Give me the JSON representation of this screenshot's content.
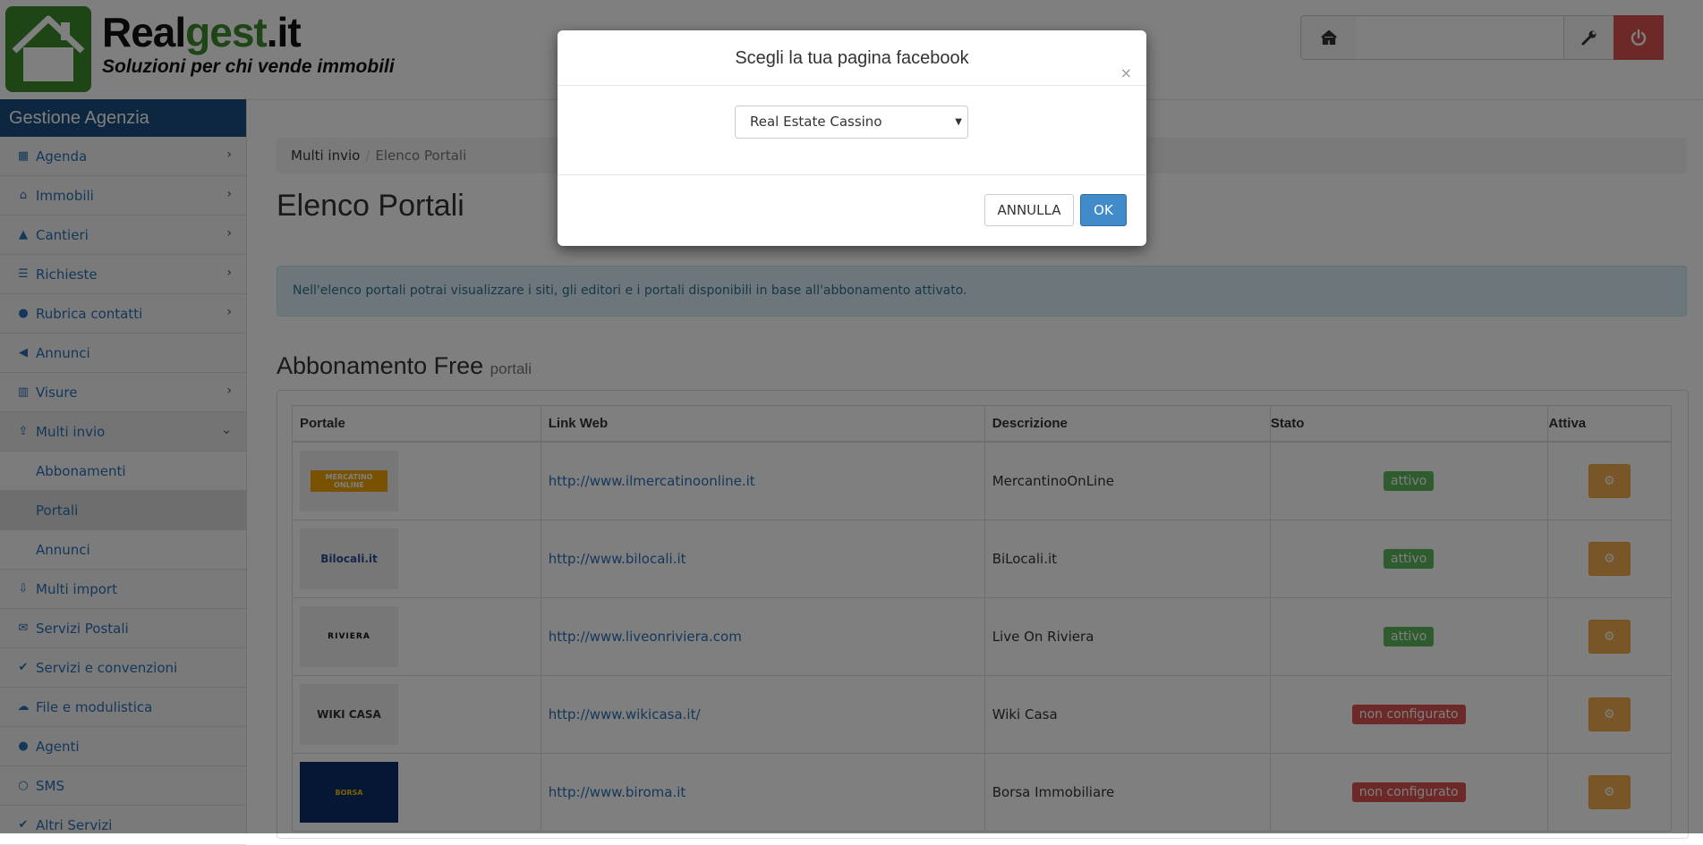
{
  "brand": {
    "name_black": "Real",
    "name_green": "gest",
    "name_suffix": ".it",
    "tagline": "Soluzioni per chi vende immobili"
  },
  "topbar": {
    "home_icon": "home-icon",
    "tools_icon": "wrench-icon",
    "power_icon": "power-icon",
    "power_color": "#d9534f"
  },
  "sidebar": {
    "title": "Gestione Agenzia",
    "items": [
      {
        "label": "Agenda",
        "icon": "calendar-icon",
        "chevron": true
      },
      {
        "label": "Immobili",
        "icon": "home-icon",
        "chevron": true
      },
      {
        "label": "Cantieri",
        "icon": "warning-icon",
        "chevron": true
      },
      {
        "label": "Richieste",
        "icon": "list-icon",
        "chevron": true
      },
      {
        "label": "Rubrica contatti",
        "icon": "users-icon",
        "chevron": true
      },
      {
        "label": "Annunci",
        "icon": "bullhorn-icon",
        "chevron": false
      },
      {
        "label": "Visure",
        "icon": "barcode-icon",
        "chevron": true
      },
      {
        "label": "Multi invio",
        "icon": "upload-icon",
        "chevron": true,
        "open": true
      },
      {
        "label": "Multi import",
        "icon": "download-icon",
        "chevron": false
      },
      {
        "label": "Servizi Postali",
        "icon": "envelope-icon",
        "chevron": false
      },
      {
        "label": "Servizi e convenzioni",
        "icon": "thumbs-up-icon",
        "chevron": false
      },
      {
        "label": "File e modulistica",
        "icon": "cloud-download-icon",
        "chevron": false
      },
      {
        "label": "Agenti",
        "icon": "user-icon",
        "chevron": false
      },
      {
        "label": "SMS",
        "icon": "comment-icon",
        "chevron": false
      },
      {
        "label": "Altri Servizi",
        "icon": "thumbs-up-icon",
        "chevron": false
      }
    ],
    "subitems": [
      {
        "label": "Abbonamenti"
      },
      {
        "label": "Portali",
        "active": true
      },
      {
        "label": "Annunci"
      }
    ]
  },
  "breadcrumb": {
    "item1": "Multi invio",
    "separator": "/",
    "item2": "Elenco Portali"
  },
  "page": {
    "title": "Elenco Portali",
    "alert": "Nell'elenco portali potrai visualizzare i siti, gli editori e i portali disponibili in base all'abbonamento attivato.",
    "section_title": "Abbonamento Free",
    "section_small": "portali"
  },
  "table": {
    "headers": [
      "Portale",
      "Link Web",
      "Descrizione",
      "Stato",
      "Attiva"
    ],
    "rows": [
      {
        "logo": "MERCATINO ONLINE",
        "link": "http://www.ilmercatinoonline.it",
        "desc": "MercantinoOnLine",
        "status": "attivo",
        "status_type": "ok"
      },
      {
        "logo": "Bilocali.it",
        "link": "http://www.bilocali.it",
        "desc": "BiLocali.it",
        "status": "attivo",
        "status_type": "ok"
      },
      {
        "logo": "RIVIERA",
        "link": "http://www.liveonriviera.com",
        "desc": "Live On Riviera",
        "status": "attivo",
        "status_type": "ok"
      },
      {
        "logo": "WIKI CASA",
        "link": "http://www.wikicasa.it/",
        "desc": "Wiki Casa",
        "status": "non configurato",
        "status_type": "ko"
      },
      {
        "logo": "BORSA",
        "link": "http://www.biroma.it",
        "desc": "Borsa Immobiliare",
        "status": "non configurato",
        "status_type": "ko"
      }
    ]
  },
  "modal": {
    "title": "Scegli la tua pagina facebook",
    "close": "×",
    "select_value": "Real Estate Cassino",
    "cancel_label": "ANNULLA",
    "ok_label": "OK"
  },
  "colors": {
    "sidebar_header": "#1c4e80",
    "link": "#2a6fb5",
    "success": "#5cb85c",
    "danger": "#d9534f",
    "warning": "#f0ad4e",
    "primary": "#428bca"
  }
}
